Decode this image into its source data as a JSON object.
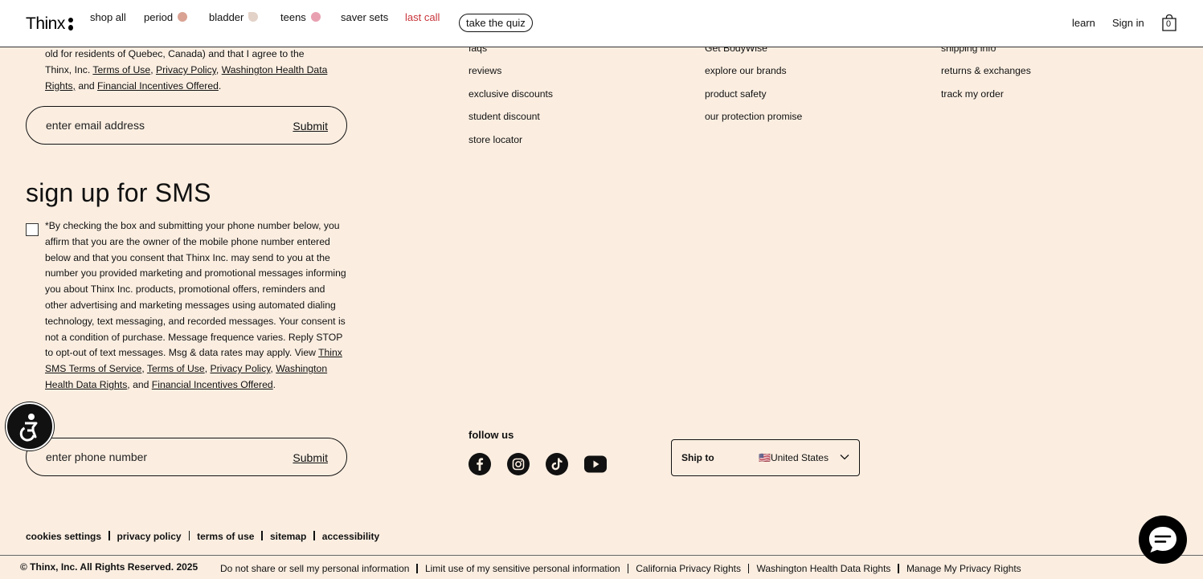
{
  "header": {
    "logo": "Thinx",
    "nav": [
      {
        "label": "shop all"
      },
      {
        "label": "period",
        "dot": "#d9a293"
      },
      {
        "label": "bladder",
        "dot": "#e3d2c8"
      },
      {
        "label": "teens",
        "dot": "#e8a0b0"
      },
      {
        "label": "saver sets"
      },
      {
        "label": "last call"
      },
      {
        "label": "take the quiz"
      }
    ],
    "learn": "learn",
    "sign_in": "Sign in",
    "cart_count": "0"
  },
  "email_signup": {
    "consent_line1": "old for residents of Quebec, Canada) and that I agree to the",
    "consent_pre": "Thinx, Inc. ",
    "terms_of_use": "Terms of Use",
    "privacy_policy": "Privacy Policy",
    "washington": "Washington Health Data Rights,",
    "and": " and ",
    "financial": "Financial Incentives Offered",
    "placeholder": "enter email address",
    "submit": "Submit"
  },
  "sms_signup": {
    "title": "sign up for SMS",
    "text": "*By checking the box and submitting your phone number below, you affirm that you are the owner of the mobile phone number entered below and that you consent that Thinx Inc. may send to you at the number you provided marketing and promotional messages informing you about Thinx Inc. products, promotional offers, reminders and other advertising and marketing messages using automated dialing technology, text messaging, and recorded messages. Your consent is not a condition of purchase. Message frequence varies. Reply STOP to opt-out of text messages. Msg & data rates may apply. View ",
    "sms_terms": "Thinx SMS Terms of Service",
    "terms_of_use": "Terms of Use",
    "privacy_policy": "Privacy Policy",
    "washington": "Washington Health Data Rights",
    "financial": "Financial Incentives Offered",
    "placeholder": "enter phone number",
    "submit": "Submit"
  },
  "columns": {
    "col1": [
      "faqs",
      "reviews",
      "exclusive discounts",
      "student discount",
      "store locator"
    ],
    "col2": [
      "Get BodyWise",
      "explore our brands",
      "product safety",
      "our protection promise"
    ],
    "col3": [
      "shipping info",
      "returns & exchanges",
      "track my order"
    ]
  },
  "follow": {
    "title": "follow us",
    "icons": [
      "facebook-icon",
      "instagram-icon",
      "tiktok-icon",
      "youtube-icon"
    ]
  },
  "ship": {
    "label": "Ship to",
    "country": "🇺🇸United States"
  },
  "footer": {
    "links": [
      "cookies settings",
      "privacy policy",
      "terms of use",
      "sitemap",
      "accessibility"
    ],
    "copyright": "© Thinx, Inc. All Rights Reserved. 2025",
    "legal": [
      "Do not share or sell my personal information",
      "Limit use of my sensitive personal information",
      "California Privacy Rights",
      "Washington Health Data Rights",
      "Manage My Privacy Rights"
    ]
  },
  "colors": {
    "background": "#fbeee1",
    "last_call": "#c8343a"
  }
}
